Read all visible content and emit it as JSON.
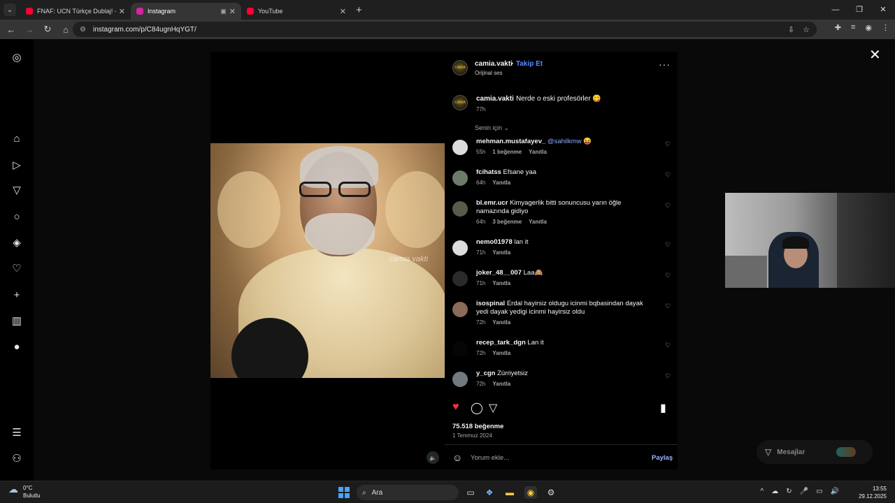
{
  "browser": {
    "tabs": [
      {
        "title": "FNAF: UCN Türkçe Dublaj! - You",
        "favicon_color": "#ff0033",
        "active": false
      },
      {
        "title": "Instagram",
        "favicon_color": "#d6249f",
        "active": true
      },
      {
        "title": "YouTube",
        "favicon_color": "#ff0033",
        "active": false
      }
    ],
    "url": "instagram.com/p/C84ugnHqYGT/"
  },
  "post": {
    "author": "camia.vakti",
    "follow_label": "Takip Et",
    "audio_label": "Orijinal ses",
    "watermark": "camia.vakti",
    "caption": {
      "user": "camia.vakti",
      "text": "Nerde o eski profesörler 😋",
      "time": "77h"
    },
    "sort_label": "Senin için",
    "comments": [
      {
        "user": "mehman.mustafayev_",
        "text": "",
        "mention": "@sahilkmw",
        "emoji": "😝",
        "time": "55h",
        "likes": "1 beğenme",
        "reply": "Yanıtla",
        "avatar_color": "#dcdcdc"
      },
      {
        "user": "fcihatss",
        "text": "Efsane yaa",
        "mention": "",
        "emoji": "",
        "time": "64h",
        "likes": "",
        "reply": "Yanıtla",
        "avatar_color": "#6e7b6a"
      },
      {
        "user": "bl.emr.ucr",
        "text": "Kimyagerlik bitti sonuncusu yarın öğle namazında gidiyo",
        "mention": "",
        "emoji": "",
        "time": "64h",
        "likes": "3 beğenme",
        "reply": "Yanıtla",
        "avatar_color": "#5a5a4a"
      },
      {
        "user": "nemo01978",
        "text": "lan it",
        "mention": "",
        "emoji": "",
        "time": "71h",
        "likes": "",
        "reply": "Yanıtla",
        "avatar_color": "#dcdcdc"
      },
      {
        "user": "joker_48__007",
        "text": "Laa🙈",
        "mention": "",
        "emoji": "",
        "time": "71h",
        "likes": "",
        "reply": "Yanıtla",
        "avatar_color": "#2a2a2a"
      },
      {
        "user": "isospinal",
        "text": "Erdal hayirsiz oldugu icinmi bqbasindan dayak yedi dayak yedigi icinmi hayirsiz oldu",
        "mention": "",
        "emoji": "",
        "time": "72h",
        "likes": "",
        "reply": "Yanıtla",
        "avatar_color": "#8a6a58"
      },
      {
        "user": "recep_tark_dgn",
        "text": "Lan it",
        "mention": "",
        "emoji": "",
        "time": "72h",
        "likes": "",
        "reply": "Yanıtla",
        "avatar_color": "#050505"
      },
      {
        "user": "y_cgn",
        "text": "Zürriyetsiz",
        "mention": "",
        "emoji": "",
        "time": "72h",
        "likes": "",
        "reply": "Yanıtla",
        "avatar_color": "#707a80"
      }
    ],
    "likes_count": "75.518 beğenme",
    "date": "1 Temmuz 2024",
    "comment_placeholder": "Yorum ekle...",
    "share_label": "Paylaş"
  },
  "messages_label": "Mesajlar",
  "taskbar": {
    "weather_temp": "0°C",
    "weather_desc": "Bulutlu",
    "search_label": "Ara",
    "time": "13:55",
    "date": "29.12.2025"
  },
  "colors": {
    "like_red": "#ff3040",
    "link_blue": "#5d8bff"
  }
}
